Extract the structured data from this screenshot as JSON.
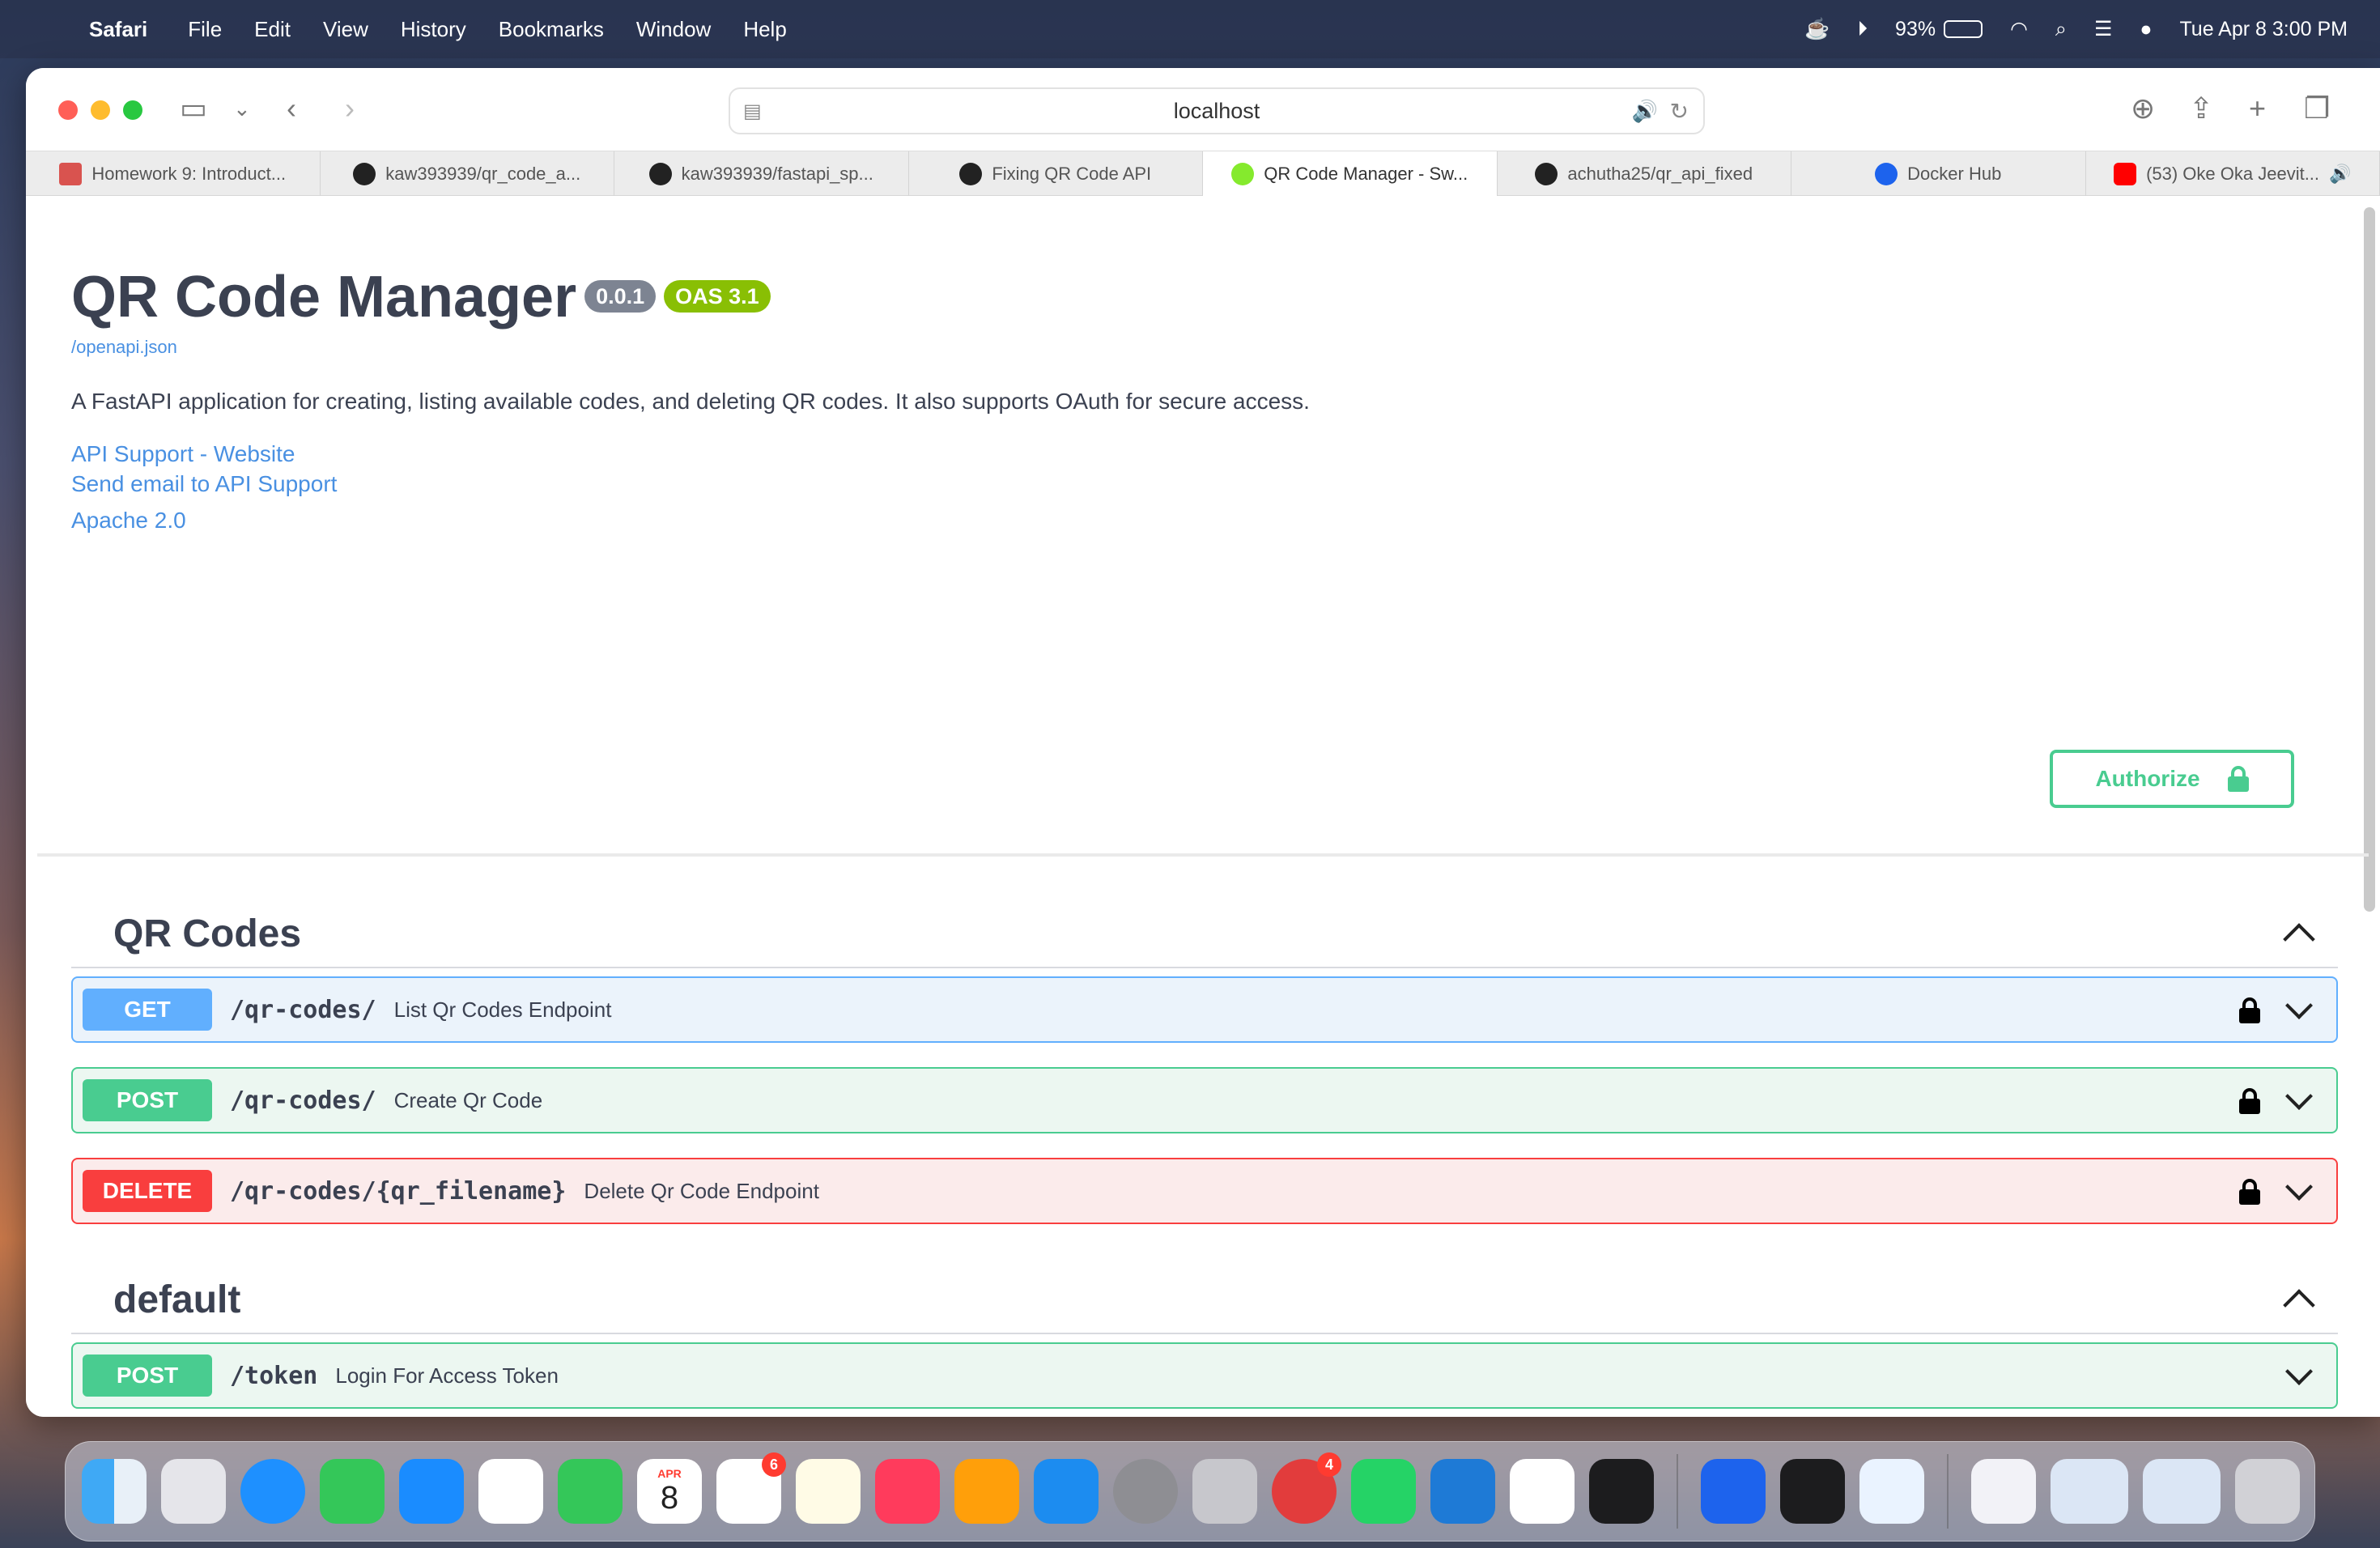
{
  "menubar": {
    "app": "Safari",
    "items": [
      "File",
      "Edit",
      "View",
      "History",
      "Bookmarks",
      "Window",
      "Help"
    ],
    "battery": "93%",
    "battery_level": 0.93,
    "datetime": "Tue Apr 8  3:00 PM"
  },
  "browser": {
    "url": "localhost",
    "tabs": [
      {
        "label": "Homework 9: Introduct...",
        "icon": "njit-icon"
      },
      {
        "label": "kaw393939/qr_code_a...",
        "icon": "github-icon"
      },
      {
        "label": "kaw393939/fastapi_sp...",
        "icon": "github-icon"
      },
      {
        "label": "Fixing QR Code API",
        "icon": "chatgpt-icon"
      },
      {
        "label": "QR Code Manager - Sw...",
        "icon": "swagger-icon",
        "active": true
      },
      {
        "label": "achutha25/qr_api_fixed",
        "icon": "github-icon"
      },
      {
        "label": "Docker Hub",
        "icon": "docker-icon"
      },
      {
        "label": "(53) Oke Oka Jeevit...",
        "icon": "youtube-icon"
      }
    ]
  },
  "api": {
    "title": "QR Code Manager",
    "version": "0.0.1",
    "oas": "OAS 3.1",
    "spec_link": "/openapi.json",
    "description": "A FastAPI application for creating, listing available codes, and deleting QR codes. It also supports OAuth for secure access.",
    "links": {
      "website": "API Support - Website",
      "email": "Send email to API Support",
      "license": "Apache 2.0"
    },
    "authorize_label": "Authorize"
  },
  "sections": [
    {
      "name": "QR Codes",
      "operations": [
        {
          "method": "GET",
          "path": "/qr-codes/",
          "summary": "List Qr Codes Endpoint",
          "locked": true
        },
        {
          "method": "POST",
          "path": "/qr-codes/",
          "summary": "Create Qr Code",
          "locked": true
        },
        {
          "method": "DELETE",
          "path": "/qr-codes/{qr_filename}",
          "summary": "Delete Qr Code Endpoint",
          "locked": true
        }
      ]
    },
    {
      "name": "default",
      "operations": [
        {
          "method": "POST",
          "path": "/token",
          "summary": "Login For Access Token",
          "locked": false
        }
      ]
    }
  ],
  "dock": {
    "calendar_month": "APR",
    "calendar_day": "8",
    "reminders_badge": "6",
    "canvas_badge": "4"
  },
  "colors": {
    "get": "#61affe",
    "post": "#49cc90",
    "delete": "#f93e3e",
    "text": "#3b4151",
    "link": "#4990e2"
  }
}
